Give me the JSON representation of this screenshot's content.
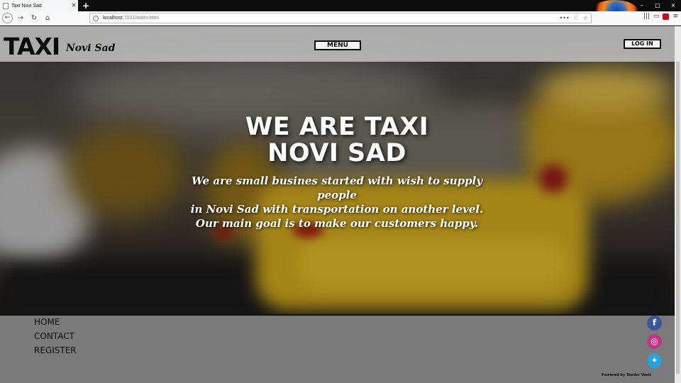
{
  "browser": {
    "tab_title": "Taxi Novi Sad",
    "tab_close": "×",
    "new_tab": "+",
    "url_host": "localhost",
    "url_path": ":7031/index.html",
    "window_controls": [
      "–",
      "□",
      "×"
    ],
    "url_actions": [
      "•••",
      "♡",
      "☆"
    ],
    "toolbar_icons": [
      "|||",
      "▭",
      "≡"
    ]
  },
  "header": {
    "logo_main": "TAXI",
    "logo_sub": "Novi Sad",
    "menu_label": "MENU",
    "login_label": "LOG IN"
  },
  "hero": {
    "title_line1": "WE ARE TAXI",
    "title_line2": "NOVI SAD",
    "text_line1": "We are small busines started with wish to supply people",
    "text_line2": "in Novi Sad with transportation on another level.",
    "text_line3": "Our main goal is to make our customers happy."
  },
  "footer": {
    "links": [
      "HOME",
      "CONTACT",
      "REGISTER"
    ],
    "social": [
      {
        "name": "facebook",
        "glyph": "f",
        "color": "#3b5998"
      },
      {
        "name": "instagram",
        "glyph": "◎",
        "color": "#c13584"
      },
      {
        "name": "twitter",
        "glyph": "✦",
        "color": "#2a9fd8"
      }
    ],
    "powered_by": "Powered by Teodor Vasić"
  },
  "colors": {
    "header_bg": "#c8c8c8",
    "footer_bg": "#7a7a7a",
    "taxi_yellow": "#c9a21d"
  }
}
